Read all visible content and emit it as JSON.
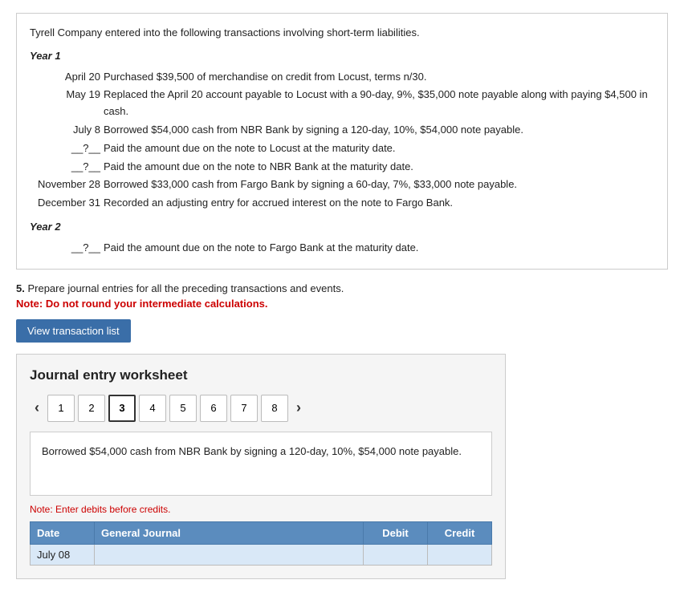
{
  "problem": {
    "intro": "Tyrell Company entered into the following transactions involving short-term liabilities.",
    "year1_header": "Year 1",
    "transactions_year1": [
      {
        "date": "April 20",
        "text": "Purchased $39,500 of merchandise on credit from Locust, terms n/30."
      },
      {
        "date": "May 19",
        "text": "Replaced the April 20 account payable to Locust with a 90-day, 9%, $35,000 note payable along with paying $4,500 in cash."
      },
      {
        "date": "July 8",
        "text": "Borrowed $54,000 cash from NBR Bank by signing a 120-day, 10%, $54,000 note payable."
      },
      {
        "date": "__?__",
        "text": "Paid the amount due on the note to Locust at the maturity date."
      },
      {
        "date": "__?__",
        "text": "Paid the amount due on the note to NBR Bank at the maturity date."
      },
      {
        "date": "November 28",
        "text": "Borrowed $33,000 cash from Fargo Bank by signing a 60-day, 7%, $33,000 note payable."
      },
      {
        "date": "December 31",
        "text": "Recorded an adjusting entry for accrued interest on the note to Fargo Bank."
      }
    ],
    "year2_header": "Year 2",
    "transactions_year2": [
      {
        "date": "__?__",
        "text": "Paid the amount due on the note to Fargo Bank at the maturity date."
      }
    ]
  },
  "instruction": {
    "number": "5.",
    "text": "Prepare journal entries for all the preceding transactions and events.",
    "note": "Note: Do not round your intermediate calculations."
  },
  "btn_view_transactions": "View transaction list",
  "journal": {
    "title": "Journal entry worksheet",
    "tabs": [
      {
        "label": "1"
      },
      {
        "label": "2"
      },
      {
        "label": "3",
        "active": true
      },
      {
        "label": "4"
      },
      {
        "label": "5"
      },
      {
        "label": "6"
      },
      {
        "label": "7"
      },
      {
        "label": "8"
      }
    ],
    "description": "Borrowed $54,000 cash from NBR Bank by signing a 120-day, 10%, $54,000 note payable.",
    "note_enter": "Note: Enter debits before credits.",
    "table": {
      "headers": [
        "Date",
        "General Journal",
        "Debit",
        "Credit"
      ],
      "rows": [
        {
          "date": "July 08",
          "general_journal": "",
          "debit": "",
          "credit": ""
        }
      ]
    }
  }
}
